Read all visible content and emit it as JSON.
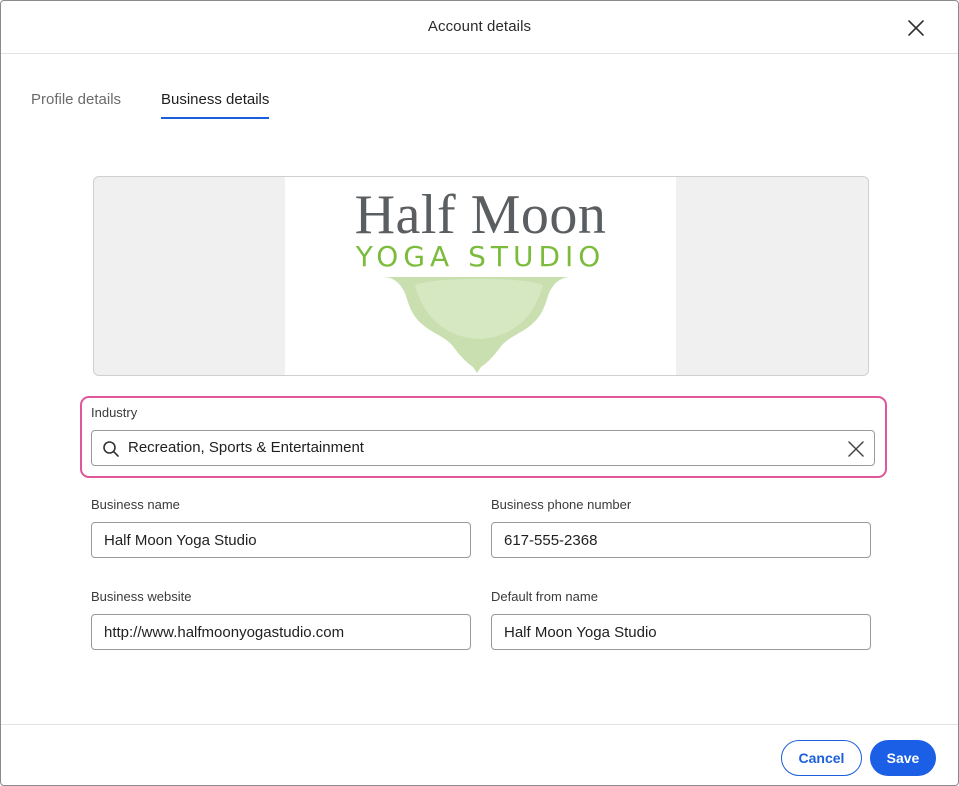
{
  "dialog": {
    "title": "Account details",
    "close_icon": "close-icon"
  },
  "tabs": [
    {
      "label": "Profile details",
      "active": false
    },
    {
      "label": "Business details",
      "active": true
    }
  ],
  "logo": {
    "title": "Half Moon",
    "subtitle": "YOGA STUDIO",
    "colors": {
      "title": "#5a5e60",
      "subtitle": "#7cbc3d",
      "lotus": "#c9dfb0"
    }
  },
  "form": {
    "industry": {
      "label": "Industry",
      "value": "Recreation, Sports & Entertainment",
      "search_icon": "search-icon",
      "clear_icon": "clear-icon",
      "highlight_color": "#e0569a"
    },
    "business_name": {
      "label": "Business name",
      "value": "Half Moon Yoga Studio"
    },
    "business_phone": {
      "label": "Business phone number",
      "value": "617-555-2368"
    },
    "business_website": {
      "label": "Business website",
      "value": "http://www.halfmoonyogastudio.com"
    },
    "default_from_name": {
      "label": "Default from name",
      "value": "Half Moon Yoga Studio"
    }
  },
  "footer": {
    "cancel_label": "Cancel",
    "save_label": "Save",
    "accent_color": "#1a5fe6"
  }
}
